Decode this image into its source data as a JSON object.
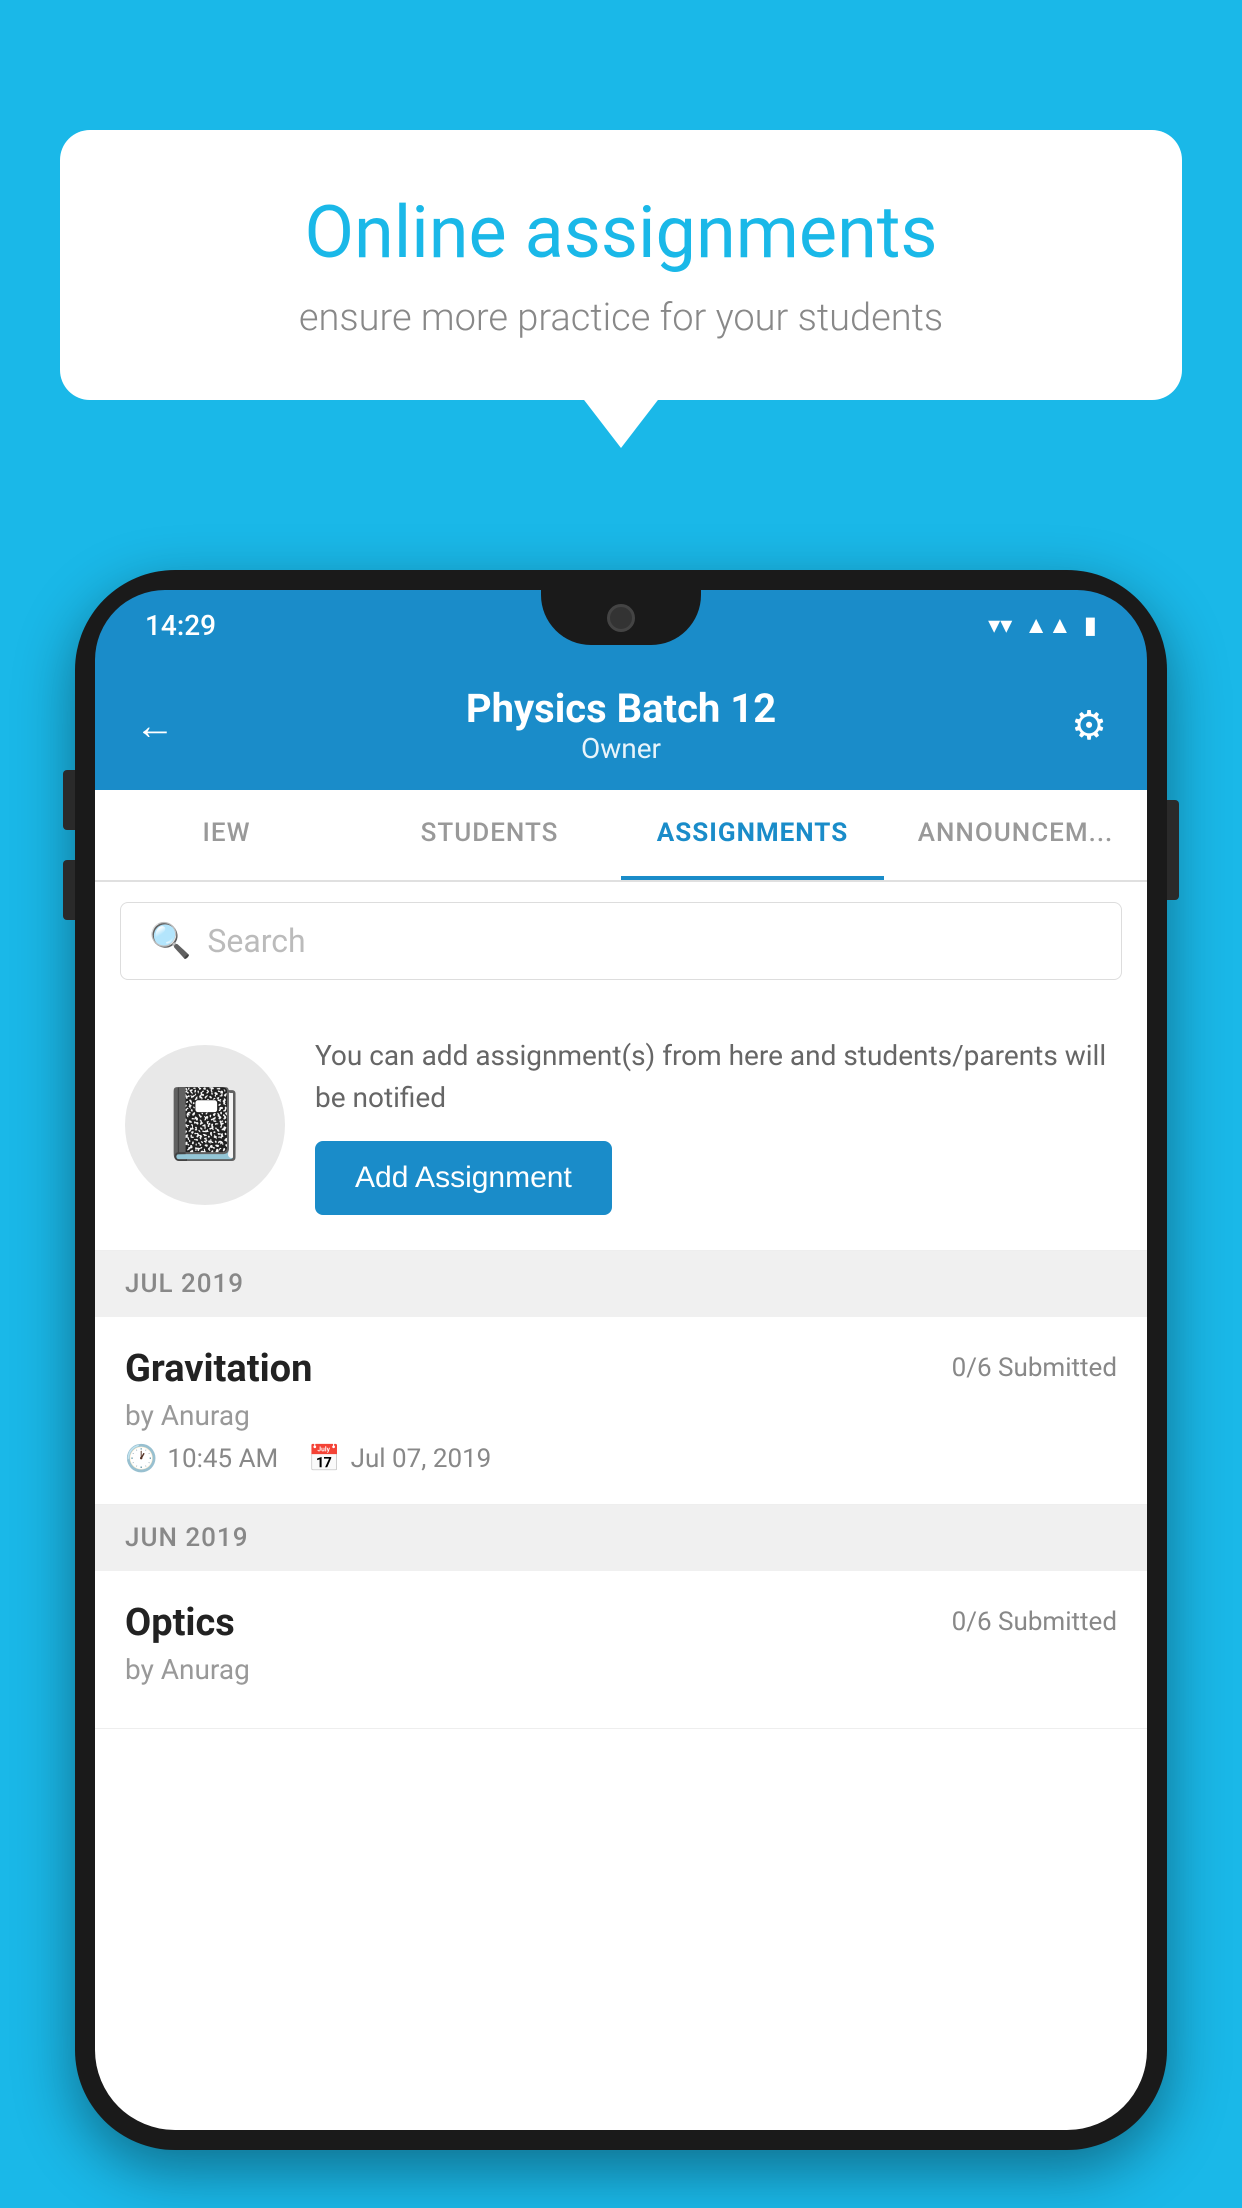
{
  "background_color": "#1ab8e8",
  "speech_bubble": {
    "title": "Online assignments",
    "subtitle": "ensure more practice for your students"
  },
  "phone": {
    "status_bar": {
      "time": "14:29",
      "icons": [
        "wifi",
        "signal",
        "battery"
      ]
    },
    "header": {
      "title": "Physics Batch 12",
      "subtitle": "Owner",
      "back_label": "←",
      "gear_label": "⚙"
    },
    "tabs": [
      {
        "label": "IEW",
        "active": false
      },
      {
        "label": "STUDENTS",
        "active": false
      },
      {
        "label": "ASSIGNMENTS",
        "active": true
      },
      {
        "label": "ANNOUNCEM...",
        "active": false
      }
    ],
    "search": {
      "placeholder": "Search"
    },
    "promo": {
      "description": "You can add assignment(s) from here and students/parents will be notified",
      "button_label": "Add Assignment"
    },
    "sections": [
      {
        "label": "JUL 2019",
        "assignments": [
          {
            "name": "Gravitation",
            "submitted": "0/6 Submitted",
            "author": "by Anurag",
            "time": "10:45 AM",
            "date": "Jul 07, 2019"
          }
        ]
      },
      {
        "label": "JUN 2019",
        "assignments": [
          {
            "name": "Optics",
            "submitted": "0/6 Submitted",
            "author": "by Anurag",
            "time": "",
            "date": ""
          }
        ]
      }
    ]
  }
}
